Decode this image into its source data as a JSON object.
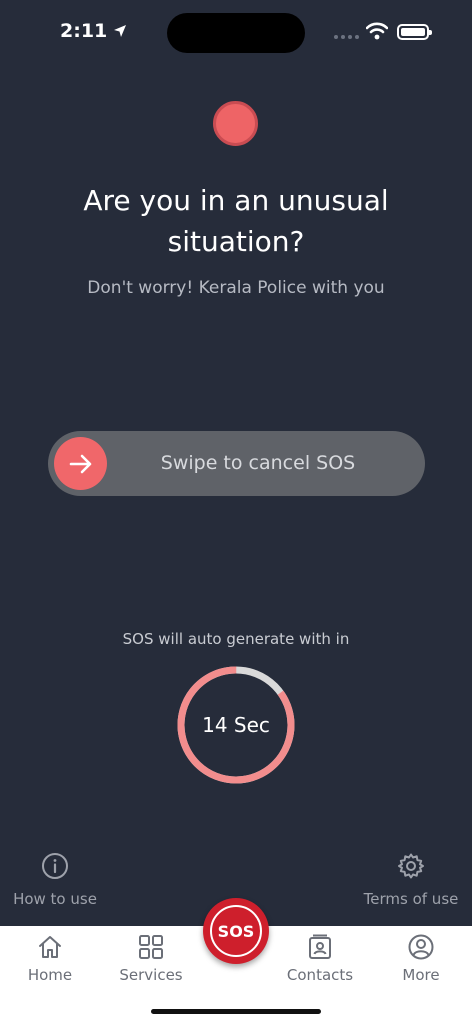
{
  "status_bar": {
    "time": "2:11",
    "location_icon": "location-arrow-icon",
    "wifi_icon": "wifi-icon",
    "battery_icon": "battery-icon"
  },
  "hero": {
    "headline": "Are you in an unusual situation?",
    "subline": "Don't worry! Kerala Police with you"
  },
  "swipe": {
    "label": "Swipe to cancel SOS",
    "handle_icon": "arrow-right-icon"
  },
  "countdown": {
    "caption": "SOS will auto generate with in",
    "value_text": "14 Sec",
    "remaining_fraction": 0.85
  },
  "links": {
    "how_to_use": {
      "label": "How to use",
      "icon": "info-icon"
    },
    "terms": {
      "label": "Terms of use",
      "icon": "gear-icon"
    }
  },
  "tab_bar": {
    "items": [
      {
        "label": "Home",
        "icon": "home-icon"
      },
      {
        "label": "Services",
        "icon": "grid-icon"
      },
      {
        "label": "Contacts",
        "icon": "contacts-icon"
      },
      {
        "label": "More",
        "icon": "user-circle-icon"
      }
    ],
    "sos_label": "SOS"
  },
  "colors": {
    "background": "#262c3a",
    "accent": "#f0676a",
    "sos_red": "#ce1f2c",
    "ring_track": "#d9d9d9"
  }
}
